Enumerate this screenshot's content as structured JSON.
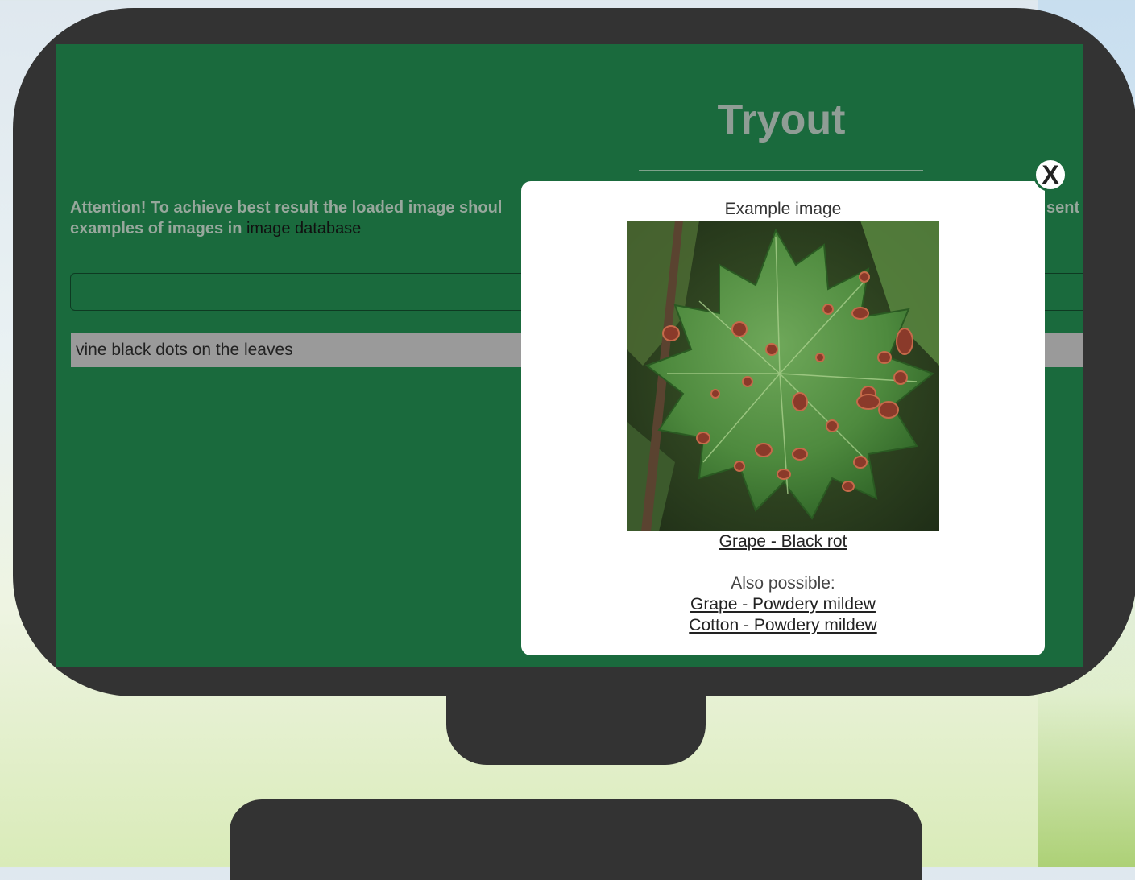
{
  "screen": {
    "title": "Tryout",
    "attention_text": "Attention! To achieve best result the loaded image shoul",
    "attention_line2": "examples of images in ",
    "database_link": "image database",
    "attention_tail": "sent",
    "query_value": "vine black dots on the leaves"
  },
  "modal": {
    "heading": "Example image",
    "result_link": "Grape - Black rot",
    "also_label": "Also possible:",
    "alternatives": [
      "Grape - Powdery mildew",
      "Cotton - Powdery mildew"
    ],
    "close_label": "X"
  },
  "colors": {
    "screen_bg": "#1a6a3d",
    "frame": "#333333",
    "modal_bg": "#ffffff"
  }
}
